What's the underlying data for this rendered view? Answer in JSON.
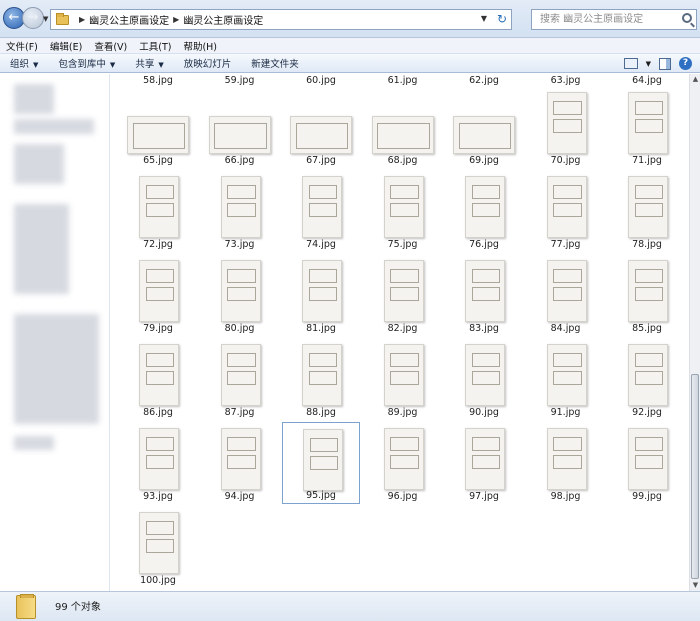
{
  "address": {
    "crumbs": [
      "幽灵公主原画设定",
      "幽灵公主原画设定"
    ],
    "search_placeholder": "搜索 幽灵公主原画设定"
  },
  "menu": [
    "文件(F)",
    "编辑(E)",
    "查看(V)",
    "工具(T)",
    "帮助(H)"
  ],
  "toolbar": {
    "organize": "组织",
    "include_library": "包含到库中",
    "share": "共享",
    "slideshow": "放映幻灯片",
    "new_folder": "新建文件夹"
  },
  "partial_row": [
    "58.jpg",
    "59.jpg",
    "60.jpg",
    "61.jpg",
    "62.jpg",
    "63.jpg",
    "64.jpg"
  ],
  "files": [
    {
      "name": "65.jpg",
      "shape": "wide"
    },
    {
      "name": "66.jpg",
      "shape": "wide"
    },
    {
      "name": "67.jpg",
      "shape": "wide"
    },
    {
      "name": "68.jpg",
      "shape": "wide"
    },
    {
      "name": "69.jpg",
      "shape": "wide"
    },
    {
      "name": "70.jpg",
      "shape": "tall"
    },
    {
      "name": "71.jpg",
      "shape": "tall"
    },
    {
      "name": "72.jpg",
      "shape": "tall"
    },
    {
      "name": "73.jpg",
      "shape": "tall"
    },
    {
      "name": "74.jpg",
      "shape": "tall"
    },
    {
      "name": "75.jpg",
      "shape": "tall"
    },
    {
      "name": "76.jpg",
      "shape": "tall"
    },
    {
      "name": "77.jpg",
      "shape": "tall"
    },
    {
      "name": "78.jpg",
      "shape": "tall"
    },
    {
      "name": "79.jpg",
      "shape": "tall"
    },
    {
      "name": "80.jpg",
      "shape": "tall"
    },
    {
      "name": "81.jpg",
      "shape": "tall"
    },
    {
      "name": "82.jpg",
      "shape": "tall"
    },
    {
      "name": "83.jpg",
      "shape": "tall"
    },
    {
      "name": "84.jpg",
      "shape": "tall"
    },
    {
      "name": "85.jpg",
      "shape": "tall"
    },
    {
      "name": "86.jpg",
      "shape": "tall"
    },
    {
      "name": "87.jpg",
      "shape": "tall"
    },
    {
      "name": "88.jpg",
      "shape": "tall"
    },
    {
      "name": "89.jpg",
      "shape": "tall"
    },
    {
      "name": "90.jpg",
      "shape": "tall"
    },
    {
      "name": "91.jpg",
      "shape": "tall"
    },
    {
      "name": "92.jpg",
      "shape": "tall"
    },
    {
      "name": "93.jpg",
      "shape": "tall"
    },
    {
      "name": "94.jpg",
      "shape": "tall"
    },
    {
      "name": "95.jpg",
      "shape": "tall",
      "selected": true
    },
    {
      "name": "96.jpg",
      "shape": "tall"
    },
    {
      "name": "97.jpg",
      "shape": "tall"
    },
    {
      "name": "98.jpg",
      "shape": "tall"
    },
    {
      "name": "99.jpg",
      "shape": "tall"
    },
    {
      "name": "100.jpg",
      "shape": "tall"
    }
  ],
  "status": {
    "count_text": "99 个对象"
  },
  "icons": {
    "back": "back-arrow-icon",
    "forward": "forward-arrow-icon",
    "folder": "folder-icon",
    "search": "search-icon",
    "view": "view-options-icon",
    "preview_pane": "preview-pane-icon",
    "help": "help-icon"
  }
}
